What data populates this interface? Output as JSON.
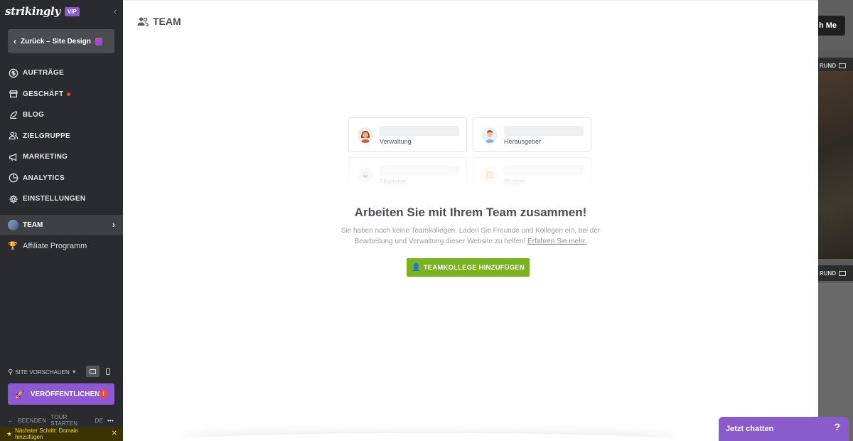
{
  "brand": {
    "logo": "strikingly",
    "badge": "VIP"
  },
  "sidebar": {
    "back_label": "Zurück – Site Design",
    "items": [
      {
        "label": "AUFTRÄGE",
        "icon": "dollar-icon"
      },
      {
        "label": "GESCHÄFT",
        "icon": "store-icon"
      },
      {
        "label": "BLOG",
        "icon": "feather-icon"
      },
      {
        "label": "ZIELGRUPPE",
        "icon": "people-icon"
      },
      {
        "label": "MARKETING",
        "icon": "megaphone-icon"
      },
      {
        "label": "ANALYTICS",
        "icon": "pie-chart-icon"
      },
      {
        "label": "EINSTELLUNGEN",
        "icon": "gear-icon"
      }
    ],
    "team_label": "TEAM",
    "affiliate_label": "Affiliate Programm",
    "preview_label": "SITE VORSCHAUEN",
    "publish_label": "VERÖFFENTLICHEN",
    "footer": {
      "exit": "BEENDEN",
      "tour": "TOUR STARTEN",
      "lang": "DE"
    },
    "next_step": "Nächster Schritt: Domain hinzufügen"
  },
  "main": {
    "title": "TEAM",
    "cards": [
      {
        "role": "Verwaltung",
        "avatar": "woman-avatar-icon"
      },
      {
        "role": "Herausgeber",
        "avatar": "man-avatar-icon"
      },
      {
        "role": "Filialleiter",
        "avatar": "bearded-man-avatar-icon"
      },
      {
        "role": "Blogger",
        "avatar": "blonde-woman-avatar-icon"
      }
    ],
    "headline": "Arbeiten Sie mit Ihrem Team zusammen!",
    "subtext": "Sie haben noch keine Teamkollegen. Laden Sie Freunde und Kollegen ein, bei der Bearbeitung und Verwaltung dieser Website zu helfen!",
    "learn_more": "Erfahren Sie mehr.",
    "add_button": "TEAMKOLLEGE HINZUFÜGEN"
  },
  "background": {
    "cta_fragment": "h Me",
    "label_1": "RUND",
    "label_2": "RUND"
  },
  "chat": {
    "label": "Jetzt chatten",
    "help": "?"
  },
  "colors": {
    "sidebar": "#2a2b2e",
    "accent_purple": "#8e58d2",
    "accent_green": "#7bb123",
    "alert_red": "#e64a4a"
  }
}
